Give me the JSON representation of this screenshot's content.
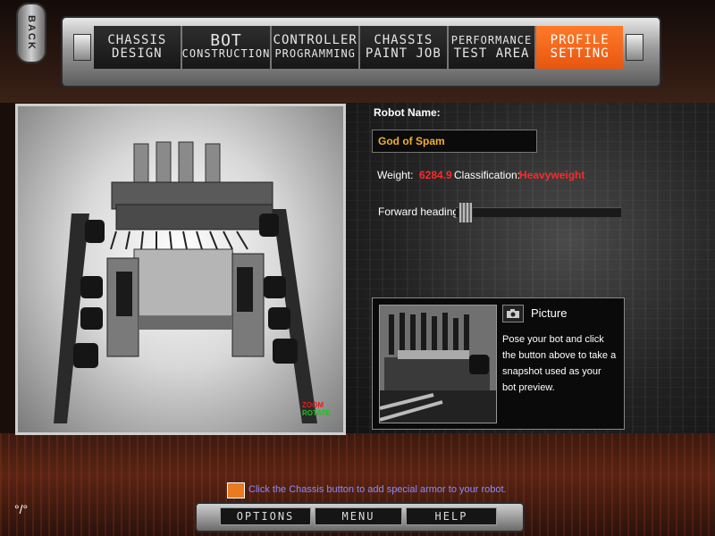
{
  "back": {
    "label": "BACK"
  },
  "nav": {
    "tabs": [
      {
        "line1": "CHASSIS",
        "line2": "DESIGN",
        "active": false
      },
      {
        "line1": "BOT",
        "line2": "CONSTRUCTION",
        "active": false
      },
      {
        "line1": "CONTROLLER",
        "line2": "PROGRAMMING",
        "active": false
      },
      {
        "line1": "CHASSIS",
        "line2": "PAINT JOB",
        "active": false
      },
      {
        "line1": "PERFORMANCE",
        "line2": "TEST AREA",
        "active": false
      },
      {
        "line1": "PROFILE",
        "line2": "SETTING",
        "active": true
      }
    ]
  },
  "preview": {
    "zoom_label": "ZOOM",
    "rotate_label": "ROTATE"
  },
  "robot": {
    "name_label": "Robot Name:",
    "name_value": "God of Spam",
    "weight_label": "Weight:",
    "weight_value": "6284.9",
    "class_label": "Classification:",
    "class_value": "Heavyweight",
    "heading_label": "Forward heading:"
  },
  "picture": {
    "title": "Picture",
    "description": "Pose your bot and click the button above to take a snapshot used as your bot preview.",
    "icon": "camera-icon"
  },
  "tip": {
    "text": "Click the Chassis button to add special armor to your robot.",
    "icon": "tips-icon"
  },
  "bottom_menu": {
    "options": "OPTIONS",
    "menu": "MENU",
    "help": "HELP"
  },
  "colors": {
    "accent": "#ff7a2a",
    "highlight_red": "#ff2a2a",
    "name_gold": "#f0b030",
    "tip_blue": "#8a8aff"
  }
}
